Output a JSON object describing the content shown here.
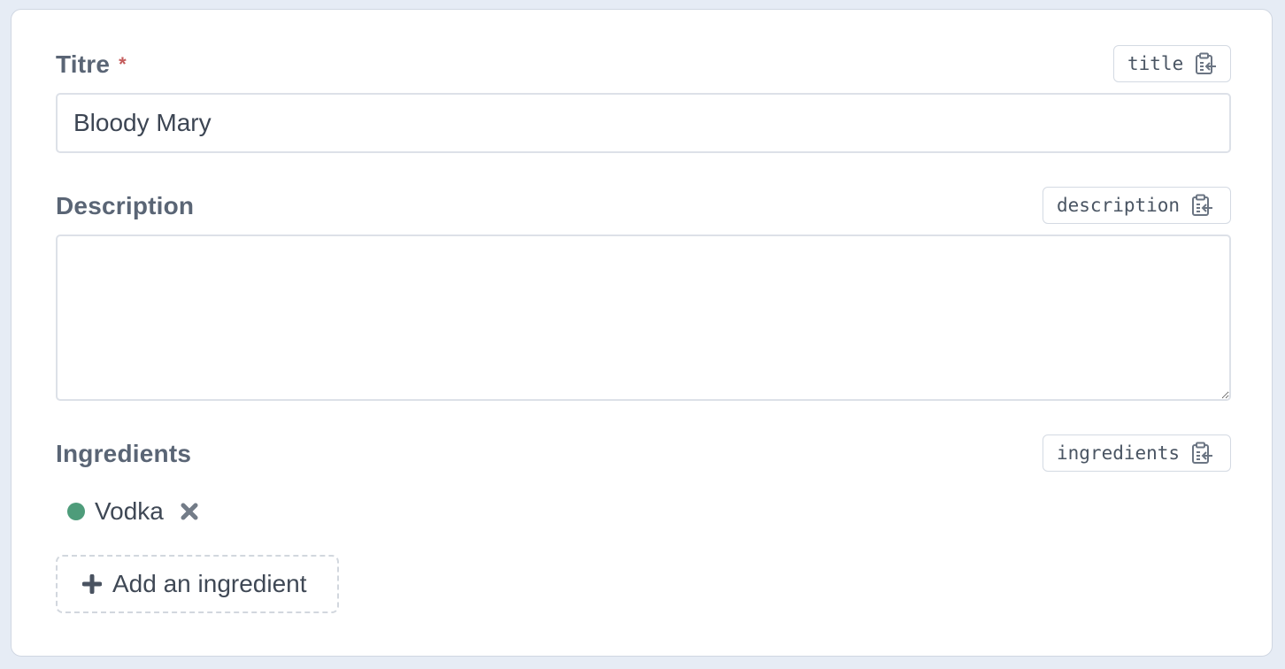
{
  "form": {
    "title_field": {
      "label": "Titre",
      "required_mark": "*",
      "key": "title",
      "value": "Bloody Mary"
    },
    "description_field": {
      "label": "Description",
      "key": "description",
      "value": ""
    },
    "ingredients_field": {
      "label": "Ingredients",
      "key": "ingredients",
      "items": [
        {
          "label": "Vodka",
          "status_color": "#4e9c7a"
        }
      ],
      "add_label": "Add an ingredient"
    }
  },
  "icons": {
    "key_chip": "clipboard-import-icon",
    "remove": "close-x-icon",
    "add": "plus-icon"
  },
  "colors": {
    "required": "#c45b5b",
    "label": "#5a6575",
    "dot": "#4e9c7a"
  }
}
